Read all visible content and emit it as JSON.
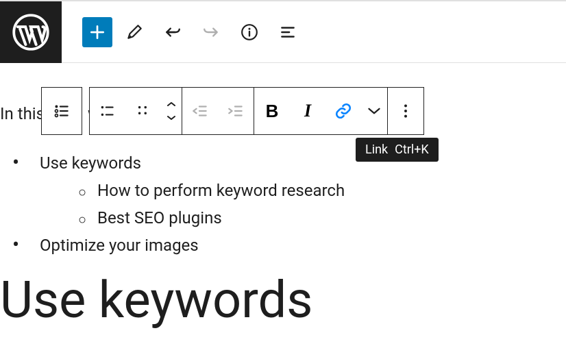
{
  "lead_text": "In this",
  "lead_tail": "w",
  "tooltip": {
    "label": "Link",
    "shortcut": "Ctrl+K"
  },
  "list": {
    "item1": "Use keywords",
    "sub1": "How to perform keyword research",
    "sub2": "Best SEO plugins",
    "item2": "Optimize your images"
  },
  "heading": "Use keywords",
  "fmt": {
    "bold": "B",
    "italic": "I"
  }
}
